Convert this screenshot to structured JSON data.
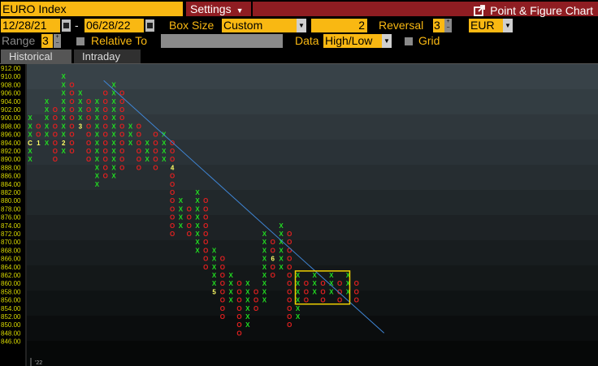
{
  "header": {
    "security": "EURO Index",
    "settings_label": "Settings",
    "chart_title": "Point & Figure Chart"
  },
  "controls": {
    "start_date": "12/28/21",
    "date_separator": "-",
    "end_date": "06/28/22",
    "box_size_label": "Box Size",
    "box_size_value": "Custom",
    "box_size_amount": "2",
    "reversal_label": "Reversal",
    "reversal_value": "3",
    "currency": "EUR",
    "range_label": "Range",
    "range_value": "3",
    "relative_to_label": "Relative To",
    "data_label": "Data",
    "data_value": "High/Low",
    "grid_label": "Grid"
  },
  "tabs": [
    {
      "label": "Historical",
      "active": true
    },
    {
      "label": "Intraday",
      "active": false
    }
  ],
  "colors": {
    "accent": "#f9b812",
    "header_red": "#8f1d22",
    "x_mark": "#22dd22",
    "o_mark": "#e02020",
    "trendline": "#3f86d6",
    "highlight_box": "#f0d000",
    "axis_text": "#d9d900"
  },
  "icons": {
    "export": "external-link-icon",
    "calendar": "calendar-icon",
    "dropdown": "chevron-down-icon"
  },
  "chart_data": {
    "type": "point-and-figure",
    "ylim": [
      846,
      912
    ],
    "y_ticks": [
      "912.00",
      "910.00",
      "908.00",
      "906.00",
      "904.00",
      "902.00",
      "900.00",
      "898.00",
      "896.00",
      "894.00",
      "892.00",
      "890.00",
      "888.00",
      "886.00",
      "884.00",
      "882.00",
      "880.00",
      "878.00",
      "876.00",
      "874.00",
      "872.00",
      "870.00",
      "868.00",
      "866.00",
      "864.00",
      "862.00",
      "860.00",
      "858.00",
      "856.00",
      "854.00",
      "852.00",
      "850.00",
      "848.00",
      "846.00"
    ],
    "x_label": "'22",
    "columns": [
      {
        "type": "X",
        "low": 890,
        "high": 900
      },
      {
        "type": "O",
        "low": 894,
        "high": 898
      },
      {
        "type": "X",
        "low": 894,
        "high": 904
      },
      {
        "type": "O",
        "low": 890,
        "high": 902
      },
      {
        "type": "X",
        "low": 892,
        "high": 910
      },
      {
        "type": "O",
        "low": 892,
        "high": 908
      },
      {
        "type": "X",
        "low": 898,
        "high": 906
      },
      {
        "type": "O",
        "low": 890,
        "high": 904
      },
      {
        "type": "X",
        "low": 884,
        "high": 904
      },
      {
        "type": "O",
        "low": 886,
        "high": 906
      },
      {
        "type": "X",
        "low": 886,
        "high": 908
      },
      {
        "type": "O",
        "low": 888,
        "high": 906
      },
      {
        "type": "X",
        "low": 894,
        "high": 898
      },
      {
        "type": "O",
        "low": 888,
        "high": 898
      },
      {
        "type": "X",
        "low": 890,
        "high": 894
      },
      {
        "type": "O",
        "low": 888,
        "high": 896
      },
      {
        "type": "X",
        "low": 890,
        "high": 896
      },
      {
        "type": "O",
        "low": 872,
        "high": 894
      },
      {
        "type": "X",
        "low": 874,
        "high": 880
      },
      {
        "type": "O",
        "low": 872,
        "high": 878
      },
      {
        "type": "X",
        "low": 868,
        "high": 882
      },
      {
        "type": "O",
        "low": 864,
        "high": 880
      },
      {
        "type": "X",
        "low": 858,
        "high": 868
      },
      {
        "type": "O",
        "low": 852,
        "high": 866
      },
      {
        "type": "X",
        "low": 856,
        "high": 862
      },
      {
        "type": "O",
        "low": 848,
        "high": 860
      },
      {
        "type": "X",
        "low": 850,
        "high": 860
      },
      {
        "type": "O",
        "low": 854,
        "high": 858
      },
      {
        "type": "X",
        "low": 856,
        "high": 872
      },
      {
        "type": "O",
        "low": 862,
        "high": 870
      },
      {
        "type": "X",
        "low": 864,
        "high": 874
      },
      {
        "type": "O",
        "low": 850,
        "high": 872
      },
      {
        "type": "X",
        "low": 852,
        "high": 862
      },
      {
        "type": "O",
        "low": 856,
        "high": 860
      },
      {
        "type": "X",
        "low": 858,
        "high": 862
      },
      {
        "type": "O",
        "low": 856,
        "high": 860
      },
      {
        "type": "X",
        "low": 858,
        "high": 862
      },
      {
        "type": "O",
        "low": 856,
        "high": 860
      },
      {
        "type": "X",
        "low": 858,
        "high": 862
      },
      {
        "type": "O",
        "low": 856,
        "high": 860
      }
    ],
    "month_markers": [
      {
        "label": "C",
        "col": 0,
        "y": 894,
        "color": "#ffff66"
      },
      {
        "label": "1",
        "col": 1,
        "y": 894,
        "color": "#ffff66"
      },
      {
        "label": "2",
        "col": 4,
        "y": 894,
        "color": "#ffff66"
      },
      {
        "label": "3",
        "col": 6,
        "y": 898,
        "color": "#ffff66"
      },
      {
        "label": "4",
        "col": 17,
        "y": 888,
        "color": "#ffff66"
      },
      {
        "label": "5",
        "col": 22,
        "y": 858,
        "color": "#ffff66"
      },
      {
        "label": "6",
        "col": 29,
        "y": 866,
        "color": "#ffff66"
      }
    ],
    "trendline": {
      "from": {
        "col": 8.8,
        "y": 909
      },
      "to": {
        "col": 42.3,
        "y": 848
      }
    },
    "highlight": {
      "col_start": 31.7,
      "col_end": 38.2,
      "y_low": 855,
      "y_high": 863
    }
  }
}
